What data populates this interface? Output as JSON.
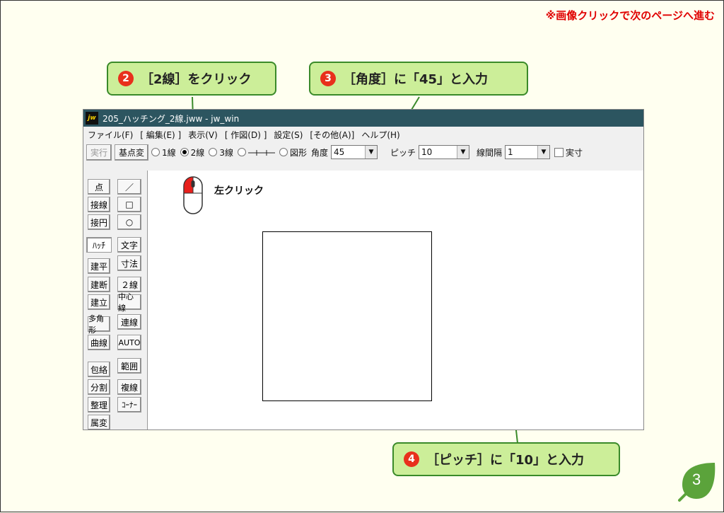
{
  "top_note": "※画像クリックで次のページへ進む",
  "callouts": [
    {
      "num": "2",
      "text": "［2線］をクリック"
    },
    {
      "num": "3",
      "text": "［角度］に「45」と入力"
    },
    {
      "num": "4",
      "text": "［ピッチ］に「10」と入力"
    }
  ],
  "window": {
    "icon": "jw",
    "title": "205_ハッチング_2線.jww - jw_win",
    "menu": [
      "ファイル(F)",
      "[ 編集(E) ]",
      "表示(V)",
      "[ 作図(D) ]",
      "設定(S)",
      "[その他(A)]",
      "ヘルプ(H)"
    ],
    "toolbar": {
      "exec": "実行",
      "base": "基点変",
      "radio1": "1線",
      "radio2": "2線",
      "radio3": "3線",
      "radio_shape": "図形",
      "angle_label": "角度",
      "angle_value": "45",
      "pitch_label": "ピッチ",
      "pitch_value": "10",
      "spacing_label": "線間隔",
      "spacing_value": "1",
      "actual_label": "実寸"
    },
    "left_col": [
      "点",
      "接線",
      "接円",
      "ﾊｯﾁ",
      "建平",
      "建断",
      "建立",
      "多角形",
      "曲線",
      "包絡",
      "分割",
      "整理",
      "属変"
    ],
    "right_col": [
      "／",
      "□",
      "○",
      "文字",
      "寸法",
      "２線",
      "中心線",
      "連線",
      "AUTO",
      "範囲",
      "複線",
      "ｺｰﾅｰ"
    ],
    "canvas_label": "左クリック"
  },
  "page_number": "3",
  "colors": {
    "accent_red": "#E00000",
    "callout_bg": "#CCEE99",
    "callout_border": "#3A8A2A",
    "titlebar": "#2C5560",
    "leaf": "#5BA33B"
  }
}
